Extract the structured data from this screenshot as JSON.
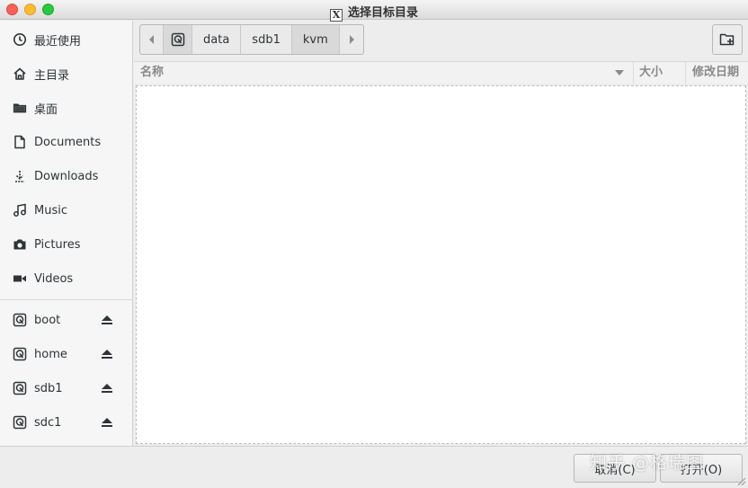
{
  "window": {
    "title": "选择目标目录",
    "x_icon": "X"
  },
  "sidebar": {
    "places": [
      {
        "label": "最近使用",
        "icon": "clock-icon"
      },
      {
        "label": "主目录",
        "icon": "home-icon"
      },
      {
        "label": "桌面",
        "icon": "folder-icon"
      },
      {
        "label": "Documents",
        "icon": "document-icon"
      },
      {
        "label": "Downloads",
        "icon": "download-icon"
      },
      {
        "label": "Music",
        "icon": "music-icon"
      },
      {
        "label": "Pictures",
        "icon": "camera-icon"
      },
      {
        "label": "Videos",
        "icon": "video-icon"
      }
    ],
    "devices": [
      {
        "label": "boot",
        "icon": "drive-icon"
      },
      {
        "label": "home",
        "icon": "drive-icon"
      },
      {
        "label": "sdb1",
        "icon": "drive-icon"
      },
      {
        "label": "sdc1",
        "icon": "drive-icon"
      }
    ]
  },
  "pathbar": {
    "segments": [
      "data",
      "sdb1",
      "kvm"
    ],
    "active_segment": "kvm"
  },
  "columns": {
    "name": "名称",
    "size": "大小",
    "modified": "修改日期"
  },
  "buttons": {
    "cancel": "取消(C)",
    "open": "打开(O)"
  },
  "watermark": "知乎 @格瑞图"
}
